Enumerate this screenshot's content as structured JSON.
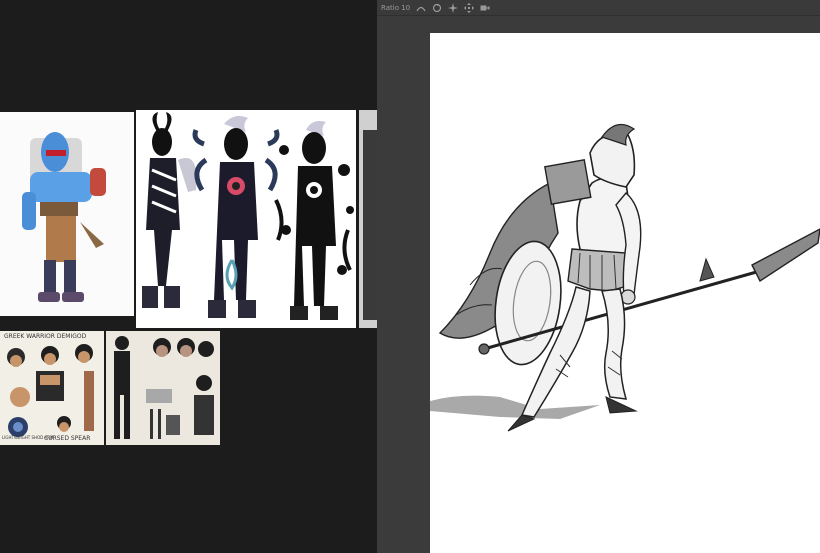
{
  "toolbar": {
    "label": "Ratio 10",
    "icons": [
      "curve-icon",
      "rotate-icon",
      "transform-icon",
      "move-icon",
      "video-icon"
    ]
  },
  "references": {
    "robot": {
      "icon": "blue-robot-character-image"
    },
    "shadow_figures": {
      "icon": "shadow-creature-characters-image"
    },
    "demigod_sheet": {
      "title": "GREEK WARRIOR DEMIGOD",
      "footer": "CURSED SPEAR",
      "note": "LIGHTWEIGHT SHOD ARM"
    },
    "model_sheet": {
      "icon": "character-model-sheet-image"
    }
  },
  "canvas": {
    "subject": "spear-warrior-sketch"
  }
}
